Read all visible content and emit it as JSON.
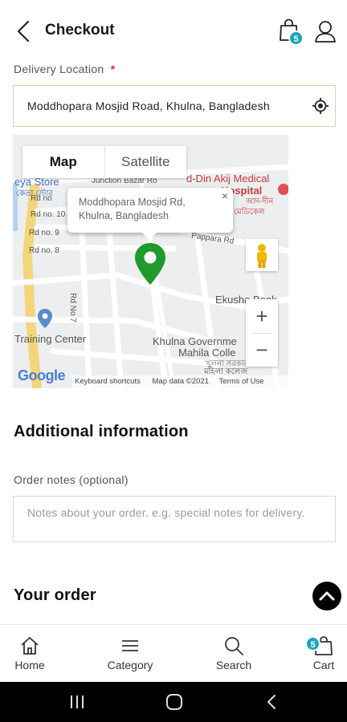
{
  "header": {
    "title": "Checkout",
    "cart_count": "5"
  },
  "delivery": {
    "label": "Delivery Location",
    "required_mark": "*",
    "value": "Moddhopara Mosjid Road, Khulna, Bangladesh"
  },
  "map": {
    "tabs": [
      "Map",
      "Satellite"
    ],
    "popup_line1": "Moddhopara Mosjid Rd,",
    "popup_line2": "Khulna, Bangladesh",
    "popup_close": "×",
    "zoom_in": "+",
    "zoom_out": "−",
    "place_labels": {
      "junction_bazar": "Junction Bazar Ro",
      "eya_store": "eya Store",
      "bengali_store": "কেতা স্টোর",
      "din_akij": "d-Din Akij Medical",
      "hospital": "Hospital",
      "hospital_bn": "আদ-দীন",
      "medical_bn": "মেডিকেল",
      "rd10": "Rd no. 10",
      "rd9": "Rd no. 9",
      "rd8": "Rd no. 8",
      "rd_top": "Rd no",
      "pappara": "Pappara Rd",
      "training": "Training Center",
      "ekusha": "Ekusha Book",
      "khulna_gov": "Khulna Governme",
      "mahila": "Mahila Colle",
      "college_bn": "মহিলা কলেজ",
      "rd7": "Rd No 7",
      "khulna_bn": "খুলনা সরকার"
    },
    "google": "Google",
    "footer_shortcuts": "Keyboard shortcuts",
    "footer_data": "Map data ©2021",
    "footer_terms": "Terms of Use"
  },
  "additional": {
    "heading": "Additional information",
    "notes_label": "Order notes (optional)",
    "notes_placeholder": "Notes about your order, e.g. special notes for delivery."
  },
  "order": {
    "heading": "Your order"
  },
  "bottom_nav": {
    "items": [
      {
        "label": "Home",
        "icon": "home-icon"
      },
      {
        "label": "Category",
        "icon": "menu-icon"
      },
      {
        "label": "Search",
        "icon": "search-icon"
      },
      {
        "label": "Cart",
        "icon": "cart-icon"
      }
    ],
    "cart_badge": "5"
  },
  "colors": {
    "accent": "#19a6b8",
    "pin": "#1f9a2c",
    "required": "#d0312d"
  }
}
